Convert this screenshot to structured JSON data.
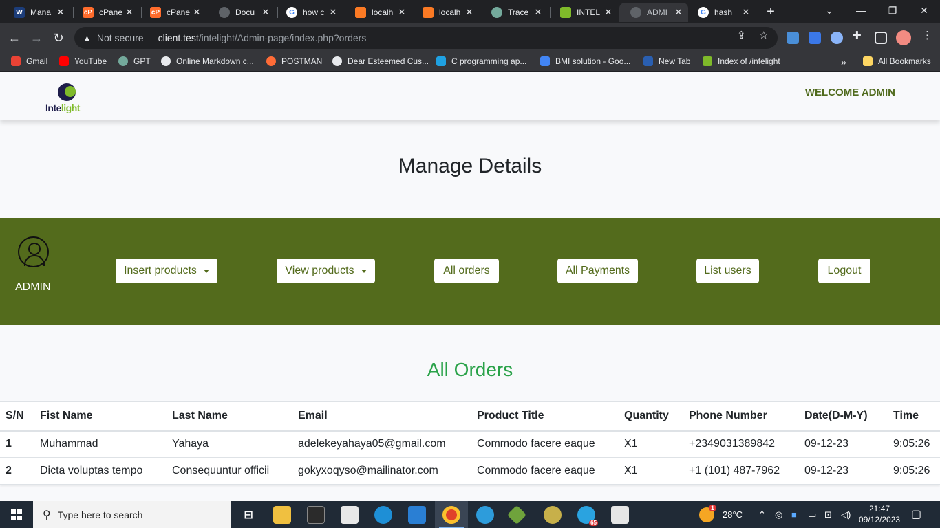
{
  "browser": {
    "tabs": [
      {
        "title": "Mana",
        "icon": "wordpress-style-icon"
      },
      {
        "title": "cPane",
        "icon": "cpanel-icon"
      },
      {
        "title": "cPane",
        "icon": "cpanel-icon"
      },
      {
        "title": "Docu",
        "icon": "globe-icon"
      },
      {
        "title": "how c",
        "icon": "google-icon"
      },
      {
        "title": "localh",
        "icon": "xampp-icon"
      },
      {
        "title": "localh",
        "icon": "xampp-icon"
      },
      {
        "title": "Trace",
        "icon": "chatgpt-icon"
      },
      {
        "title": "INTEL",
        "icon": "intelight-icon"
      },
      {
        "title": "ADMI",
        "icon": "globe-icon"
      },
      {
        "title": "hash",
        "icon": "google-icon"
      }
    ],
    "active_tab_index": 9,
    "address": {
      "security": "Not secure",
      "host": "client.test",
      "path": "/intelight/Admin-page/index.php?orders"
    },
    "bookmarks": [
      {
        "label": "Gmail",
        "color": "#ea4335"
      },
      {
        "label": "YouTube",
        "color": "#ff0000"
      },
      {
        "label": "GPT",
        "color": "#74aa9c"
      },
      {
        "label": "Online Markdown c...",
        "color": "#e8eaed"
      },
      {
        "label": "POSTMAN",
        "color": "#ff6c37"
      },
      {
        "label": "Dear Esteemed Cus...",
        "color": "#e8eaed"
      },
      {
        "label": "C programming ap...",
        "color": "#1fa1e2"
      },
      {
        "label": "BMI solution - Goo...",
        "color": "#4285f4"
      },
      {
        "label": "New Tab",
        "color": "#2a5fb0"
      },
      {
        "label": "Index of /intelight",
        "color": "#7fba2a"
      }
    ],
    "all_bookmarks": "All Bookmarks"
  },
  "site": {
    "logo": {
      "part1": "Inte",
      "part2": "light"
    },
    "welcome": "WELCOME ADMIN",
    "heading": "Manage Details",
    "admin_label": "ADMIN",
    "nav": {
      "insert": "Insert products",
      "view": "View products",
      "orders": "All orders",
      "payments": "All Payments",
      "users": "List users",
      "logout": "Logout"
    },
    "orders_title": "All Orders",
    "table": {
      "headers": [
        "S/N",
        "Fist Name",
        "Last Name",
        "Email",
        "Product Title",
        "Quantity",
        "Phone Number",
        "Date(D-M-Y)",
        "Time"
      ],
      "rows": [
        [
          "1",
          "Muhammad",
          "Yahaya",
          "adelekeyahaya05@gmail.com",
          "Commodo facere eaque",
          "X1",
          "+2349031389842",
          "09-12-23",
          "9:05:26"
        ],
        [
          "2",
          "Dicta voluptas tempo",
          "Consequuntur officii",
          "gokyxoqyso@mailinator.com",
          "Commodo facere eaque",
          "X1",
          "+1 (101) 487-7962",
          "09-12-23",
          "9:05:26"
        ]
      ]
    }
  },
  "taskbar": {
    "search_placeholder": "Type here to search",
    "weather": "28°C",
    "time": "21:47",
    "date": "09/12/2023",
    "badge": "1",
    "telegram_count": "65"
  },
  "colors": {
    "brand_green": "#536b1c",
    "orders_green": "#2aa249",
    "logo_navy": "#1e1d4a",
    "logo_lime": "#7fba2a"
  }
}
